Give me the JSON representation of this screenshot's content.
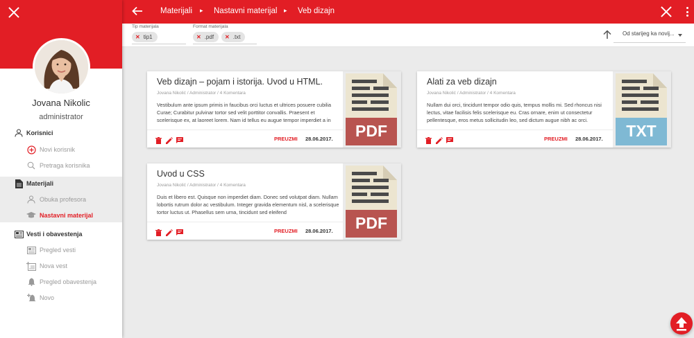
{
  "app": {
    "accent": "#e21e25"
  },
  "sidebar": {
    "user_name": "Jovana Nikolic",
    "user_role": "administrator",
    "sections": [
      {
        "label": "Korisnici",
        "icon": "person-icon",
        "items": [
          {
            "label": "Novi korisnik",
            "icon": "add-circle-icon"
          },
          {
            "label": "Pretraga korisnika",
            "icon": "search-icon"
          }
        ]
      },
      {
        "label": "Materijali",
        "icon": "document-icon",
        "items": [
          {
            "label": "Obuka profesora",
            "icon": "person-icon"
          },
          {
            "label": "Nastavni materijal",
            "icon": "graduation-cap-icon",
            "active": true
          }
        ]
      },
      {
        "label": "Vesti i obavestenja",
        "icon": "news-icon",
        "items": [
          {
            "label": "Pregled vesti",
            "icon": "news-icon"
          },
          {
            "label": "Nova vest",
            "icon": "add-news-icon"
          },
          {
            "label": "Pregled obavestenja",
            "icon": "bell-icon"
          },
          {
            "label": "Novo",
            "icon": "add-bell-icon"
          }
        ]
      }
    ]
  },
  "topbar": {
    "breadcrumbs": [
      "Materijali",
      "Nastavni materijal",
      "Veb dizajn"
    ]
  },
  "filters": {
    "type_label": "Tip materijala",
    "type_chips": [
      "tip1"
    ],
    "format_label": "Format materijala",
    "format_chips": [
      ".pdf",
      ".txt"
    ],
    "sort_value": "Od starijeg ka novij..."
  },
  "cards": [
    {
      "title": "Veb dizajn – pojam i istorija. Uvod u HTML.",
      "meta": "Jovana Nikolić / Administrator / 4 Komentara",
      "body": "Vestibulum ante ipsum primis in faucibus orci luctus et ultrices posuere cubilia Curae; Curabitur pulvinar tortor sed velit porttitor convallis. Praesent et scelerisque ex, at laoreet lorem. Nam id tellus eu augue tempor imperdiet a in",
      "download": "PREUZMI",
      "date": "28.06.2017.",
      "file_type": "PDF",
      "file_color": "#b85450"
    },
    {
      "title": "Alati za veb dizajn",
      "meta": "Jovana Nikolić / Administrator / 4 Komentara",
      "body": "Nullam dui orci, tincidunt tempor odio quis, tempus mollis mi. Sed rhoncus nisi lectus, vitae facilisis felis scelerisque eu. Cras ornare, enim ut consectetur pellentesque, eros metus sollicitudin leo, sed dictum augue nibh ac orci.",
      "download": "PREUZMI",
      "date": "28.06.2017.",
      "file_type": "TXT",
      "file_color": "#7fb9d4"
    },
    {
      "title": "Uvod u CSS",
      "meta": "Jovana Nikolić / Administrator / 4 Komentara",
      "body": "Duis et libero est. Quisque non imperdiet diam. Donec sed volutpat diam. Nullam lobortis rutrum dolor ac vestibulum. Integer gravida elementum nisl, a scelerisque tortor luctus ut. Phasellus sem urna, tincidunt sed eleifend",
      "download": "PREUZMI",
      "date": "28.06.2017.",
      "file_type": "PDF",
      "file_color": "#b85450"
    }
  ]
}
